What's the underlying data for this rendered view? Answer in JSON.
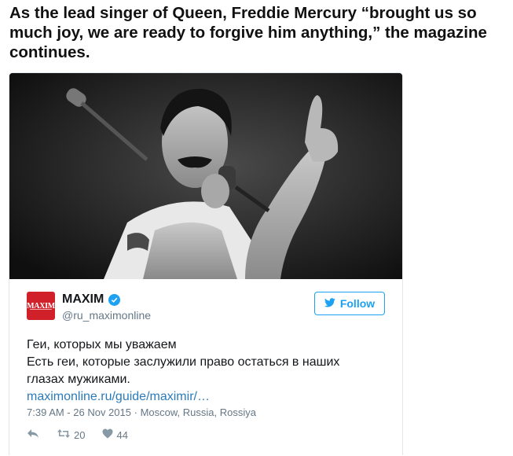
{
  "article": {
    "paragraph": "As the lead singer of Queen, Freddie Mercury “brought us so much joy, we are ready to forgive him anything,” the magazine continues."
  },
  "tweet": {
    "avatar_text": "MAXIM",
    "display_name": "MAXIM",
    "handle": "@ru_maximonline",
    "follow_label": "Follow",
    "text_lines": [
      "Геи, которых мы уважаем",
      "Есть геи, которые заслужили право остаться в наших",
      "глазах мужиками."
    ],
    "link": "maximonline.ru/guide/maximir/…",
    "timestamp": "7:39 AM - 26 Nov 2015",
    "location": "Moscow, Russia, Rossiya",
    "retweet_count": "20",
    "like_count": "44"
  },
  "colors": {
    "twitter_blue": "#1da1f2",
    "link_blue": "#2b7bb9",
    "meta_gray": "#657786",
    "avatar_red": "#d0202a"
  },
  "icons": [
    "microphone-photo",
    "verified-icon",
    "twitter-bird-icon",
    "reply-icon",
    "retweet-icon",
    "heart-icon"
  ]
}
